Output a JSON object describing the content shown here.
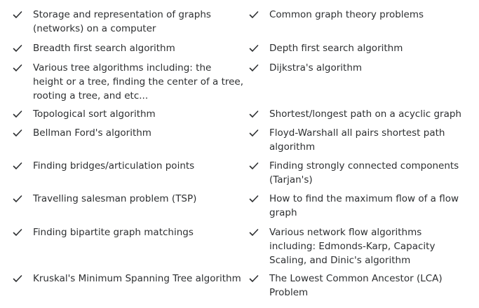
{
  "check_icon": "check-icon",
  "text_color": "#2d2f31",
  "left_column": [
    {
      "label": "Storage and representation of graphs (networks) on a computer"
    },
    {
      "label": "Breadth first search algorithm"
    },
    {
      "label": "Various tree algorithms including: the height or a tree, finding the center of a tree, rooting a tree, and etc..."
    },
    {
      "label": "Topological sort algorithm"
    },
    {
      "label": "Bellman Ford's algorithm"
    },
    {
      "label": "Finding bridges/articulation points"
    },
    {
      "label": "Travelling salesman problem (TSP)"
    },
    {
      "label": "Finding bipartite graph matchings"
    },
    {
      "label": "Kruskal's Minimum Spanning Tree algorithm"
    }
  ],
  "right_column": [
    {
      "label": "Common graph theory problems"
    },
    {
      "label": "Depth first search algorithm"
    },
    {
      "label": "Dijkstra's algorithm"
    },
    {
      "label": "Shortest/longest path on a acyclic graph"
    },
    {
      "label": "Floyd-Warshall all pairs shortest path algorithm"
    },
    {
      "label": "Finding strongly connected components (Tarjan's)"
    },
    {
      "label": "How to find the maximum flow of a flow graph"
    },
    {
      "label": "Various network flow algorithms including: Edmonds-Karp, Capacity Scaling, and Dinic's algorithm"
    },
    {
      "label": "The Lowest Common Ancestor (LCA) Problem"
    }
  ]
}
